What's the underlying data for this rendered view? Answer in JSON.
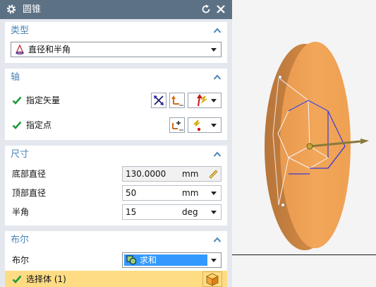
{
  "dialog": {
    "title": "圆锥",
    "icons": {
      "settings": "gear-icon",
      "reset": "reset-icon",
      "close": "close-icon"
    }
  },
  "type_section": {
    "title": "类型",
    "selected": "直径和半角",
    "icon": "cone-icon"
  },
  "axis_section": {
    "title": "轴",
    "vector_label": "指定矢量",
    "point_label": "指定点"
  },
  "dimensions_section": {
    "title": "尺寸",
    "rows": [
      {
        "label": "底部直径",
        "value": "130.0000",
        "unit": "mm"
      },
      {
        "label": "顶部直径",
        "value": "50",
        "unit": "mm"
      },
      {
        "label": "半角",
        "value": "15",
        "unit": "deg"
      }
    ]
  },
  "boolean_section": {
    "title": "布尔",
    "label": "布尔",
    "selected": "求和",
    "select_body_label": "选择体 (1)"
  },
  "colors": {
    "title_bar": "#5d7184",
    "section_title": "#4b84b6",
    "check": "#1f9a3a",
    "highlight": "#fedc84",
    "selected_blue": "#3399ff",
    "model_orange": "#f0a456"
  }
}
